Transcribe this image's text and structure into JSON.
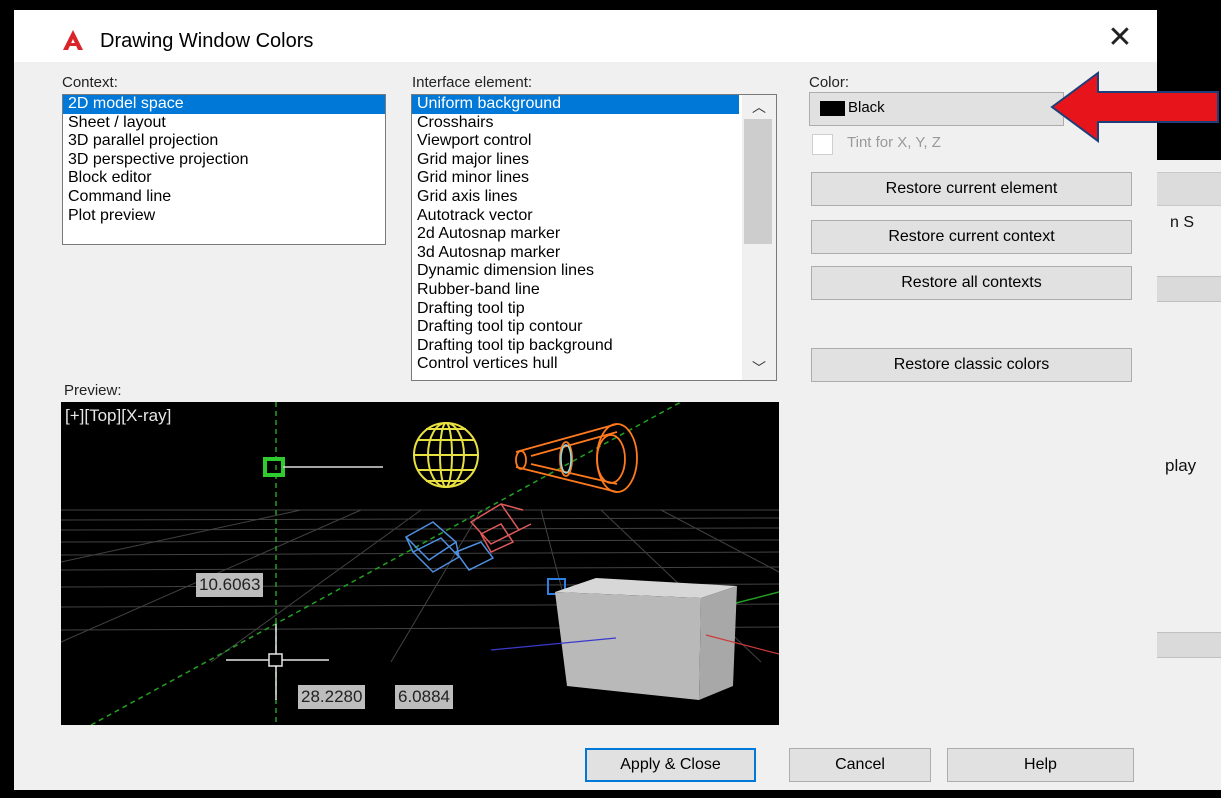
{
  "dialog": {
    "title": "Drawing Window Colors",
    "close_glyph": "✕",
    "icon": "autocad-logo-icon"
  },
  "context": {
    "label": "Context:",
    "items": [
      "2D model space",
      "Sheet / layout",
      "3D parallel projection",
      "3D perspective projection",
      "Block editor",
      "Command line",
      "Plot preview"
    ],
    "selected": "2D model space"
  },
  "interface": {
    "label": "Interface element:",
    "items": [
      "Uniform background",
      "Crosshairs",
      "Viewport control",
      "Grid major lines",
      "Grid minor lines",
      "Grid axis lines",
      "Autotrack vector",
      "2d Autosnap marker",
      "3d Autosnap marker",
      "Dynamic dimension lines",
      "Rubber-band line",
      "Drafting tool tip",
      "Drafting tool tip contour",
      "Drafting tool tip background",
      "Control vertices hull"
    ],
    "selected": "Uniform background"
  },
  "color": {
    "label": "Color:",
    "value": "Black",
    "swatch": "#000000",
    "tint_label": "Tint for X, Y, Z"
  },
  "buttons": {
    "restore_element": "Restore current element",
    "restore_context": "Restore current context",
    "restore_all": "Restore all contexts",
    "restore_classic": "Restore classic colors",
    "apply_close": "Apply & Close",
    "cancel": "Cancel",
    "help": "Help"
  },
  "preview": {
    "label": "Preview:",
    "viewport_label": "[+][Top][X-ray]",
    "dim1": "10.6063",
    "dim2": "28.2280",
    "dim3": "6.0884"
  },
  "background_app": {
    "text1": "n S",
    "text2": "play"
  },
  "colors": {
    "selection": "#0078d7",
    "arrow": "#e8141b",
    "preview_bg": "#000000"
  }
}
